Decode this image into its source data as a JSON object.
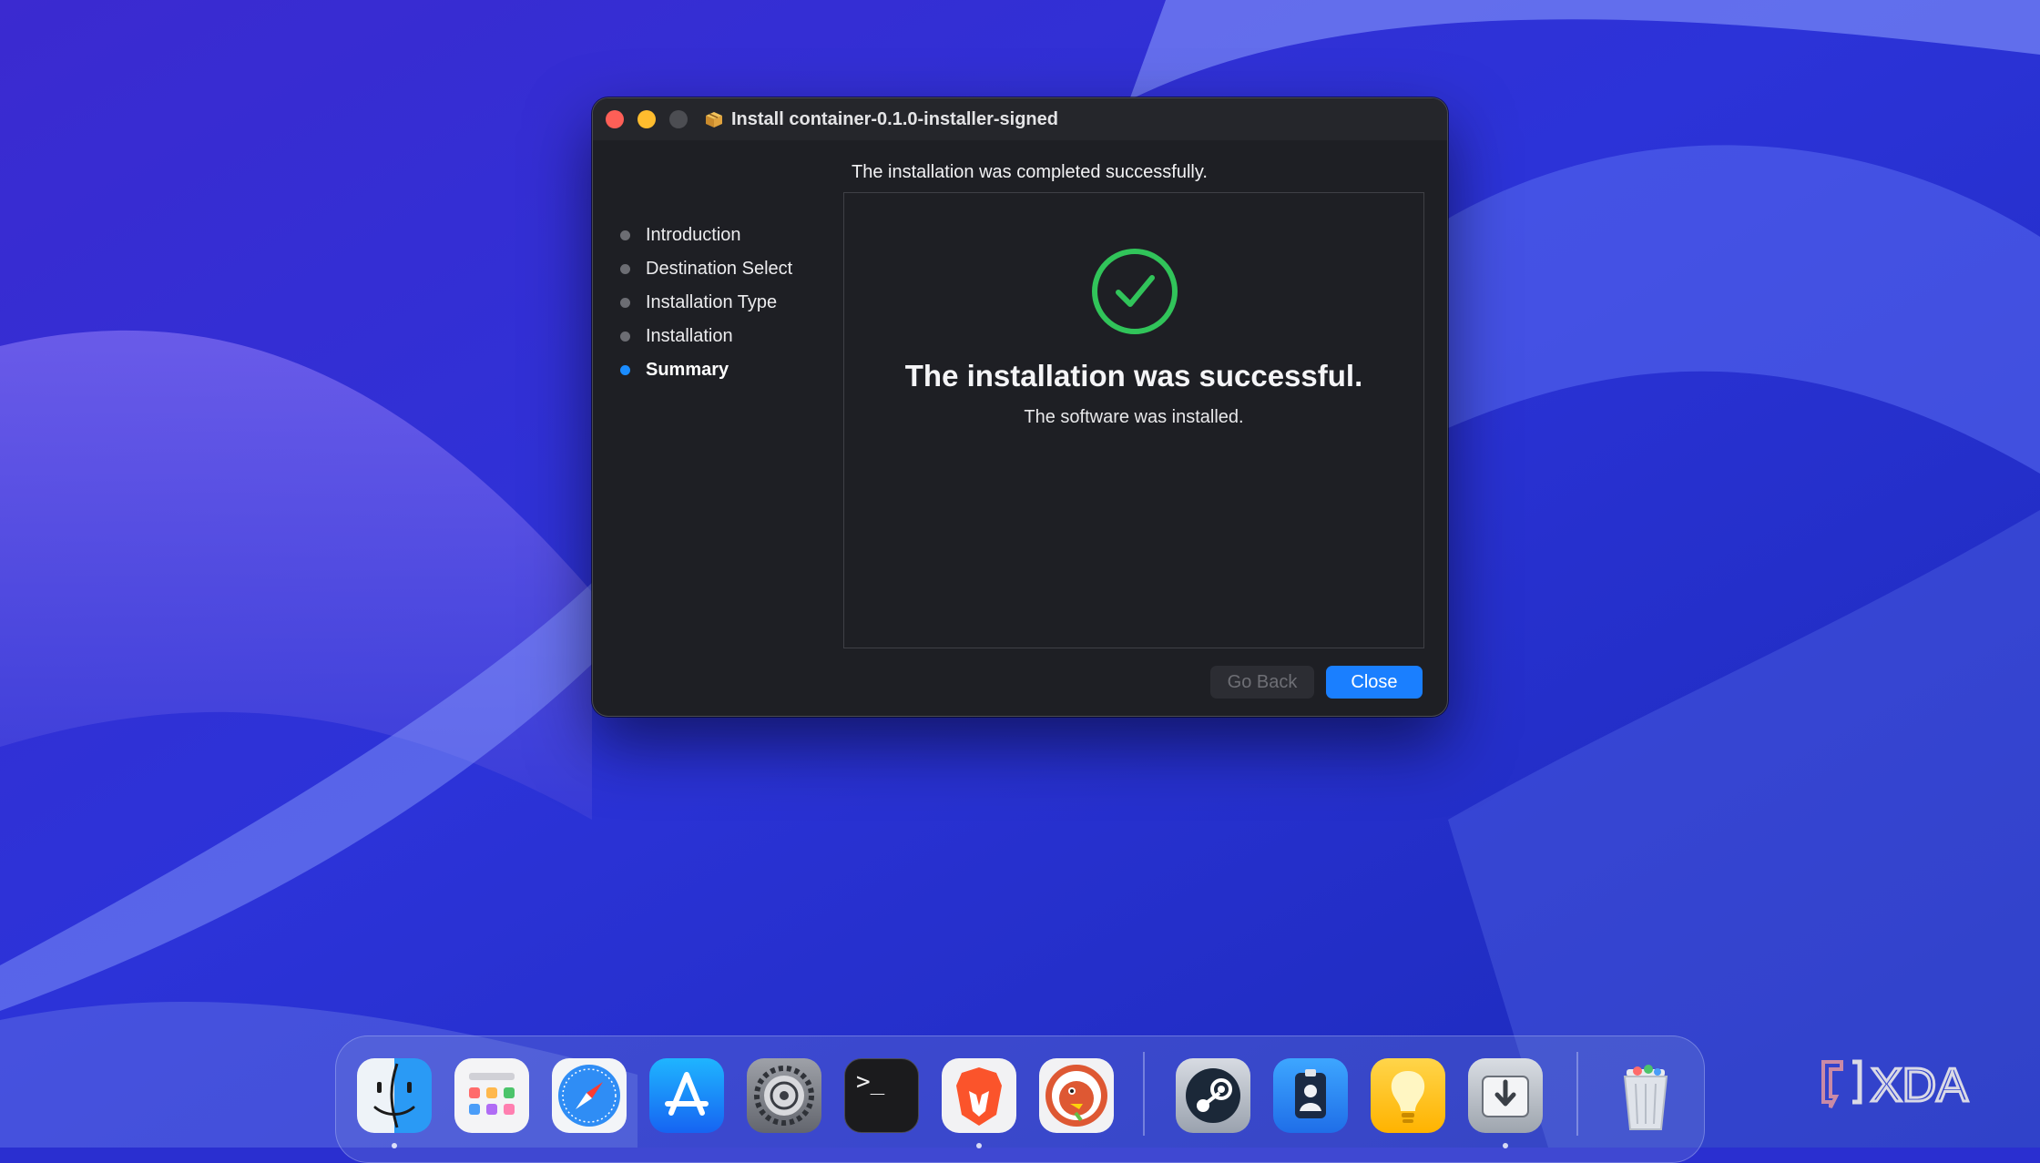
{
  "window": {
    "title": "Install container-0.1.0-installer-signed",
    "steps": [
      {
        "label": "Introduction",
        "active": false
      },
      {
        "label": "Destination Select",
        "active": false
      },
      {
        "label": "Installation Type",
        "active": false
      },
      {
        "label": "Installation",
        "active": false
      },
      {
        "label": "Summary",
        "active": true
      }
    ],
    "heading": "The installation was completed successfully.",
    "result_title": "The installation was successful.",
    "result_subtitle": "The software was installed.",
    "buttons": {
      "back": "Go Back",
      "close": "Close"
    },
    "colors": {
      "accent": "#1a7fff",
      "success": "#31c45a",
      "background": "#1e1f24"
    }
  },
  "dock": {
    "apps": [
      {
        "name": "Finder",
        "icon": "finder-icon"
      },
      {
        "name": "Launchpad",
        "icon": "launchpad-icon"
      },
      {
        "name": "Safari",
        "icon": "safari-icon"
      },
      {
        "name": "App Store",
        "icon": "app-store-icon"
      },
      {
        "name": "System Settings",
        "icon": "system-settings-icon"
      },
      {
        "name": "Terminal",
        "icon": "terminal-icon"
      },
      {
        "name": "Brave",
        "icon": "brave-icon"
      },
      {
        "name": "DuckDuckGo",
        "icon": "duckduckgo-icon"
      },
      {
        "name": "Steam",
        "icon": "steam-icon"
      },
      {
        "name": "Badge",
        "icon": "id-badge-icon"
      },
      {
        "name": "Tips",
        "icon": "lightbulb-icon"
      },
      {
        "name": "Installer",
        "icon": "installer-icon"
      },
      {
        "name": "Trash",
        "icon": "trash-icon"
      }
    ],
    "terminal_prompt": ">_"
  },
  "watermark": "XDA"
}
